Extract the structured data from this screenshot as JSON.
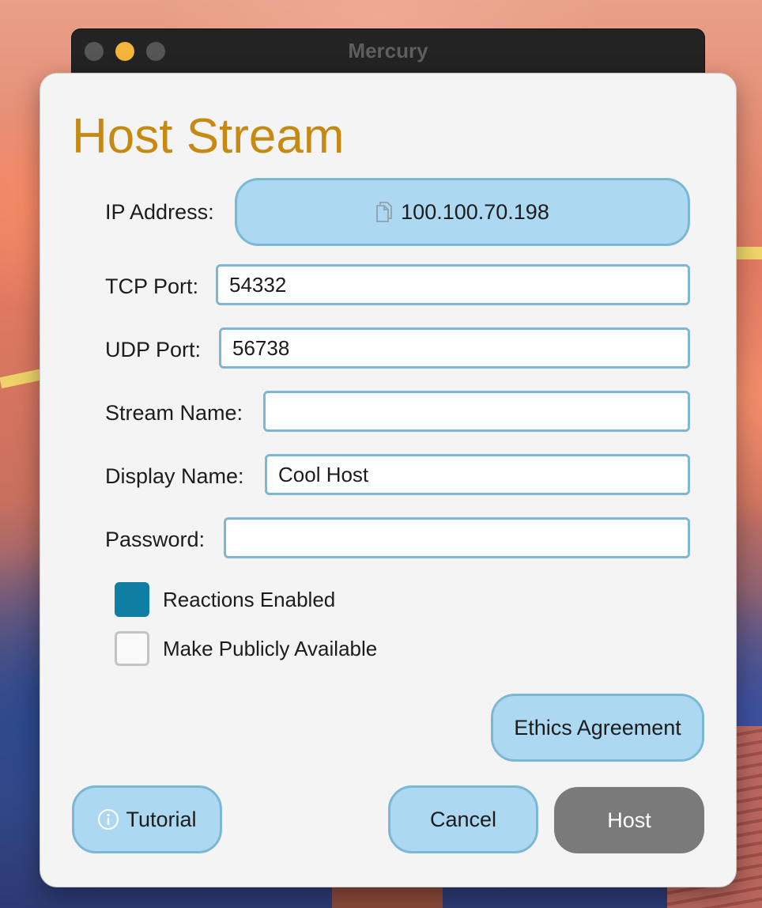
{
  "window": {
    "title": "Mercury"
  },
  "dialog": {
    "title": "Host Stream",
    "ip": {
      "label": "IP Address:",
      "value": "100.100.70.198",
      "icon": "copy-icon"
    },
    "tcp": {
      "label": "TCP Port:",
      "value": "54332"
    },
    "udp": {
      "label": "UDP Port:",
      "value": "56738"
    },
    "stream_name": {
      "label": "Stream Name:",
      "value": ""
    },
    "display_name": {
      "label": "Display Name:",
      "value": "Cool Host"
    },
    "password": {
      "label": "Password:",
      "value": ""
    },
    "reactions": {
      "label": "Reactions Enabled",
      "checked": true
    },
    "public": {
      "label": "Make Publicly Available",
      "checked": false
    },
    "ethics_label": "Ethics Agreement",
    "tutorial_label": "Tutorial",
    "tutorial_icon": "info-icon",
    "cancel_label": "Cancel",
    "host_label": "Host"
  },
  "colors": {
    "title": "#c68a12",
    "button_bg": "#acd8f1",
    "button_border": "#7ab8d6",
    "checkbox_on": "#0e7fa3",
    "host_button": "#7a7a7a"
  }
}
